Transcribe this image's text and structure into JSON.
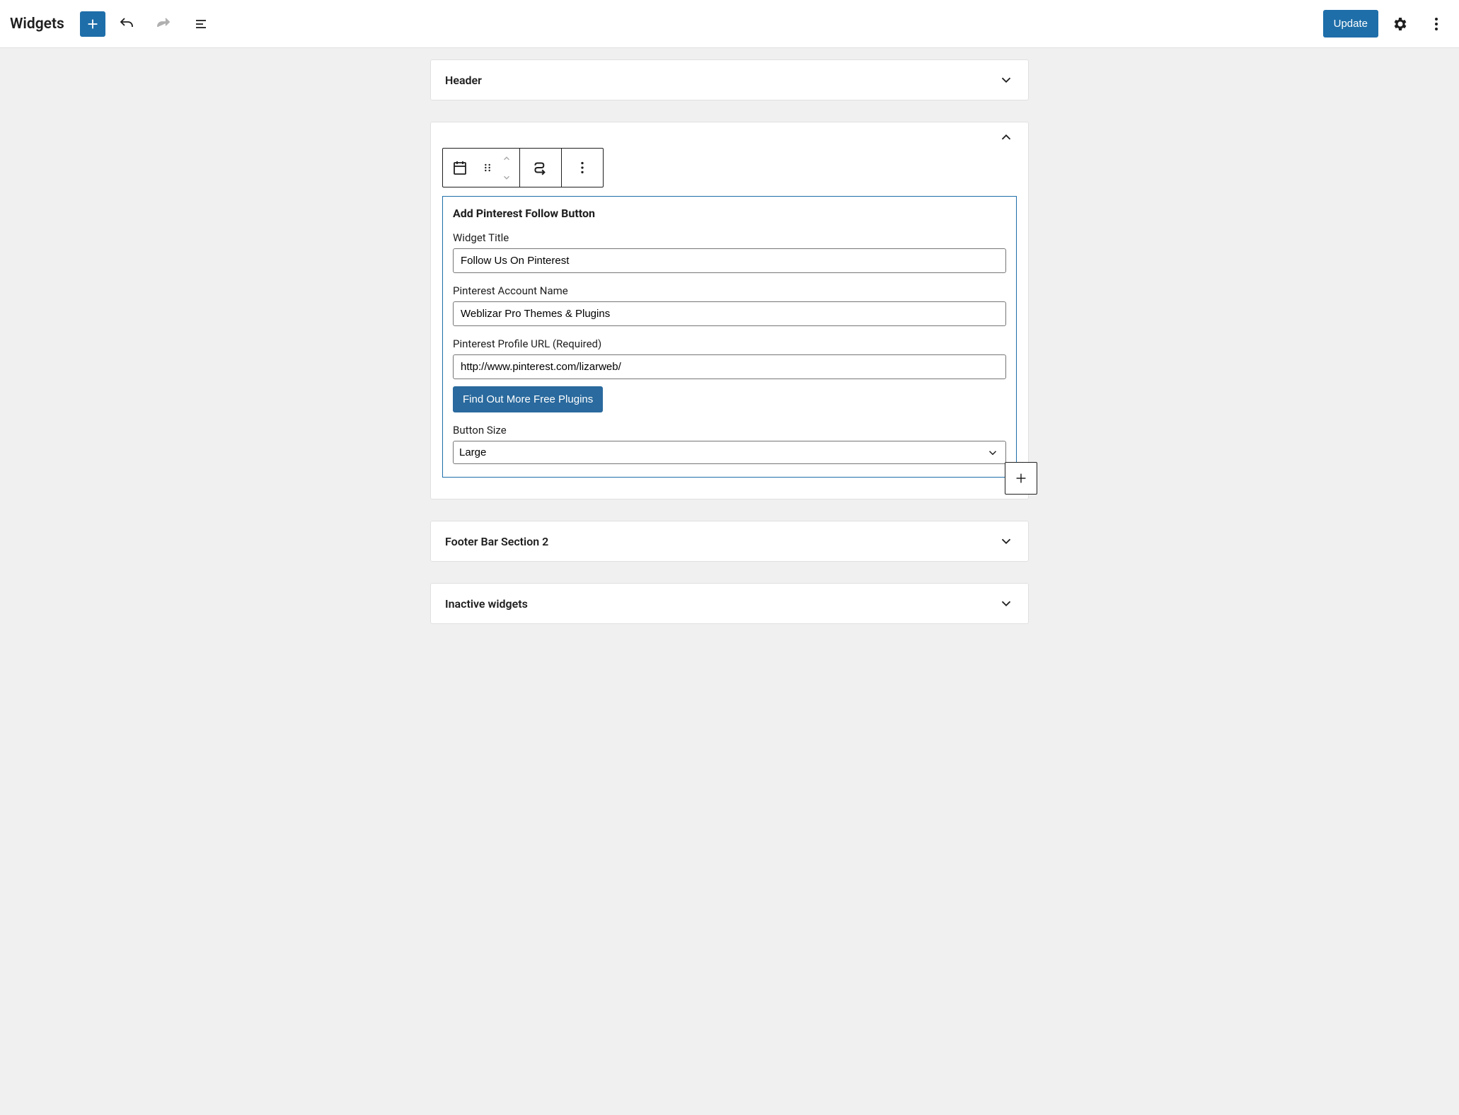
{
  "header": {
    "title": "Widgets",
    "update_label": "Update"
  },
  "areas": {
    "header_title": "Header",
    "footer_title": "Footer Bar Section 2",
    "inactive_title": "Inactive widgets"
  },
  "widget": {
    "heading": "Add Pinterest Follow Button",
    "fields": {
      "title_label": "Widget Title",
      "title_value": "Follow Us On Pinterest",
      "account_label": "Pinterest Account Name",
      "account_value": "Weblizar Pro Themes & Plugins",
      "url_label": "Pinterest Profile URL (Required)",
      "url_value": "http://www.pinterest.com/lizarweb/",
      "more_plugins_label": "Find Out More Free Plugins",
      "size_label": "Button Size",
      "size_value": "Large"
    }
  }
}
